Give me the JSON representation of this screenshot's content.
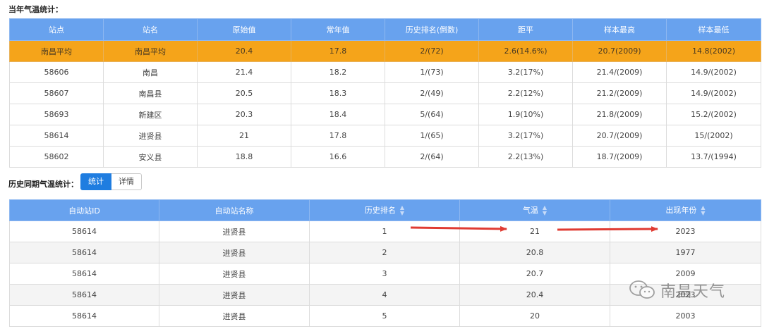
{
  "current": {
    "title": "当年气温统计：",
    "headers": [
      "站点",
      "站名",
      "原始值",
      "常年值",
      "历史排名(倒数)",
      "距平",
      "样本最高",
      "样本最低"
    ],
    "rows": [
      [
        "南昌平均",
        "南昌平均",
        "20.4",
        "17.8",
        "2/(72)",
        "2.6(14.6%)",
        "20.7(2009)",
        "14.8(2002)"
      ],
      [
        "58606",
        "南昌",
        "21.4",
        "18.2",
        "1/(73)",
        "3.2(17%)",
        "21.4/(2009)",
        "14.9/(2002)"
      ],
      [
        "58607",
        "南昌县",
        "20.5",
        "18.3",
        "2/(49)",
        "2.2(12%)",
        "21.2/(2009)",
        "14.9/(2002)"
      ],
      [
        "58693",
        "新建区",
        "20.3",
        "18.4",
        "5/(64)",
        "1.9(10%)",
        "21.8/(2009)",
        "15.2/(2002)"
      ],
      [
        "58614",
        "进贤县",
        "21",
        "17.8",
        "1/(65)",
        "3.2(17%)",
        "20.7/(2009)",
        "15/(2002)"
      ],
      [
        "58602",
        "安义县",
        "18.8",
        "16.6",
        "2/(64)",
        "2.2(13%)",
        "18.7/(2009)",
        "13.7/(1994)"
      ]
    ]
  },
  "history": {
    "title": "历史同期气温统计：",
    "tabs": [
      "统计",
      "详情"
    ],
    "headers": [
      "自动站ID",
      "自动站名称",
      "历史排名",
      "气温",
      "出现年份"
    ],
    "sortable": [
      false,
      false,
      true,
      true,
      true
    ],
    "rows": [
      [
        "58614",
        "进贤县",
        "1",
        "21",
        "2023"
      ],
      [
        "58614",
        "进贤县",
        "2",
        "20.8",
        "1977"
      ],
      [
        "58614",
        "进贤县",
        "3",
        "20.7",
        "2009"
      ],
      [
        "58614",
        "进贤县",
        "4",
        "20.4",
        "2023"
      ],
      [
        "58614",
        "进贤县",
        "5",
        "20",
        "2003"
      ]
    ]
  },
  "watermark": {
    "text": "南昌天气",
    "icon": "wechat-icon"
  },
  "colors": {
    "header": "#68a2ee",
    "highlight": "#f5a41a",
    "tab_active": "#1f7de0",
    "arrow": "#e03b32"
  }
}
